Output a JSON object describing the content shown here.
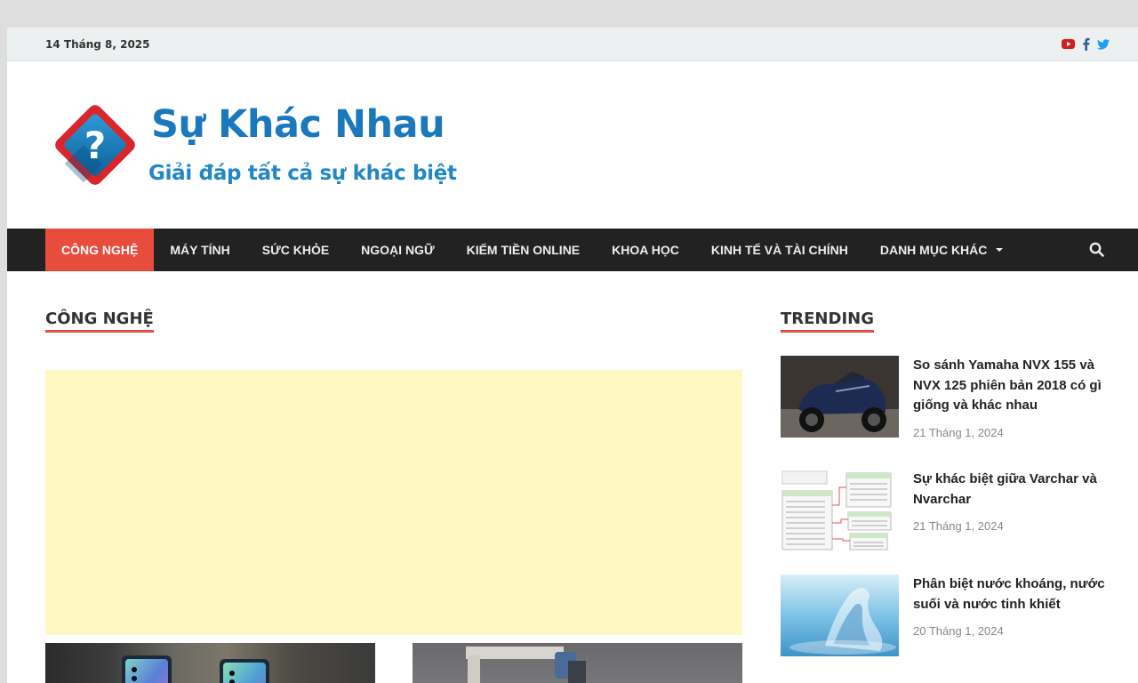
{
  "topbar": {
    "date": "14 Tháng 8, 2025",
    "social_icons": [
      "youtube-icon",
      "facebook-icon",
      "twitter-icon"
    ]
  },
  "site": {
    "title": "Sự Khác Nhau",
    "tagline": "Giải đáp tất cả sự khác biệt"
  },
  "nav": {
    "items": [
      {
        "label": "CÔNG NGHỆ",
        "active": true
      },
      {
        "label": "MÁY TÍNH"
      },
      {
        "label": "SỨC KHỎE"
      },
      {
        "label": "NGOẠI NGỮ"
      },
      {
        "label": "KIẾM TIỀN ONLINE"
      },
      {
        "label": "KHOA HỌC"
      },
      {
        "label": "KINH TẾ VÀ TÀI CHÍNH"
      },
      {
        "label": "DANH MỤC KHÁC",
        "has_dropdown": true
      }
    ]
  },
  "main": {
    "section_title": "CÔNG NGHỆ"
  },
  "trending": {
    "title": "TRENDING",
    "items": [
      {
        "headline": "So sánh Yamaha NVX 155 và NVX 125 phiên bản 2018 có gì giống và khác nhau",
        "date": "21 Tháng 1, 2024"
      },
      {
        "headline": "Sự khác biệt giữa Varchar và Nvarchar",
        "date": "21 Tháng 1, 2024"
      },
      {
        "headline": "Phân biệt nước khoáng, nước suối và nước tinh khiết",
        "date": "20 Tháng 1, 2024"
      }
    ]
  },
  "colors": {
    "accent": "#e74c3c",
    "nav_bg": "#222222",
    "brand_blue": "#1a79bd",
    "ad_bg": "#fff8c2"
  }
}
